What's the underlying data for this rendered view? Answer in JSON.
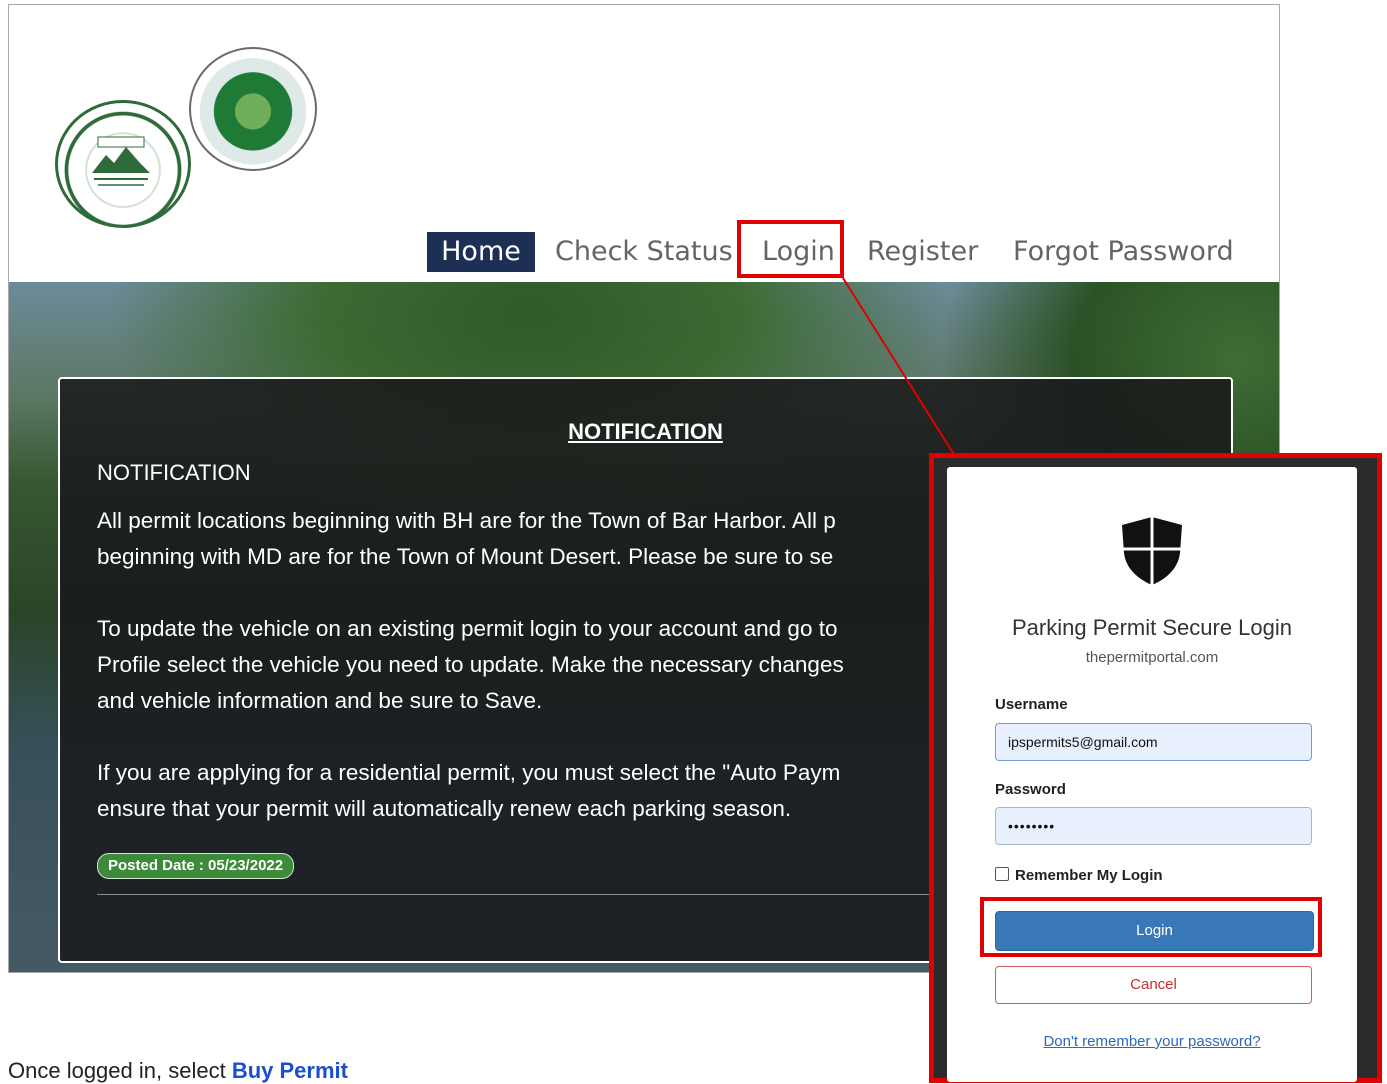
{
  "nav": {
    "items": [
      "Home",
      "Check Status",
      "Login",
      "Register",
      "Forgot Password"
    ],
    "active": "Home"
  },
  "notice": {
    "title": "NOTIFICATION",
    "heading": "NOTIFICATION",
    "paragraphs": [
      "All permit locations beginning with BH are for the Town of Bar Harbor.  All p",
      "beginning with MD are for the Town of Mount Desert.  Please be sure to se",
      "To update the vehicle on an existing permit login to your account and go to",
      "Profile select the vehicle you need to update. Make the necessary changes",
      "and vehicle information and be sure to Save.",
      "If you are applying for a residential permit, you must select the \"Auto Paym",
      "ensure that your permit will automatically renew each parking season."
    ],
    "posted_date": "Posted Date : 05/23/2022"
  },
  "bottom_text": {
    "prefix": "Once logged in, select ",
    "link": "Buy Permit"
  },
  "login_modal": {
    "icon": "shield-icon",
    "title": "Parking Permit Secure Login",
    "subtitle": "thepermitportal.com",
    "username_label": "Username",
    "username_value": "ipspermits5@gmail.com",
    "password_label": "Password",
    "password_value": "••••••••",
    "remember_label": "Remember My Login",
    "login_button": "Login",
    "cancel_button": "Cancel",
    "forgot_link": "Don't remember your password?"
  },
  "colors": {
    "highlight": "#e00000",
    "nav_active_bg": "#1c2f54",
    "login_button": "#3878b8",
    "cancel_text": "#cc2e2e",
    "posted_badge": "#3c8a3a"
  },
  "logos": [
    "Town of Bar Harbor seal",
    "Town of Mount Desert seal"
  ]
}
